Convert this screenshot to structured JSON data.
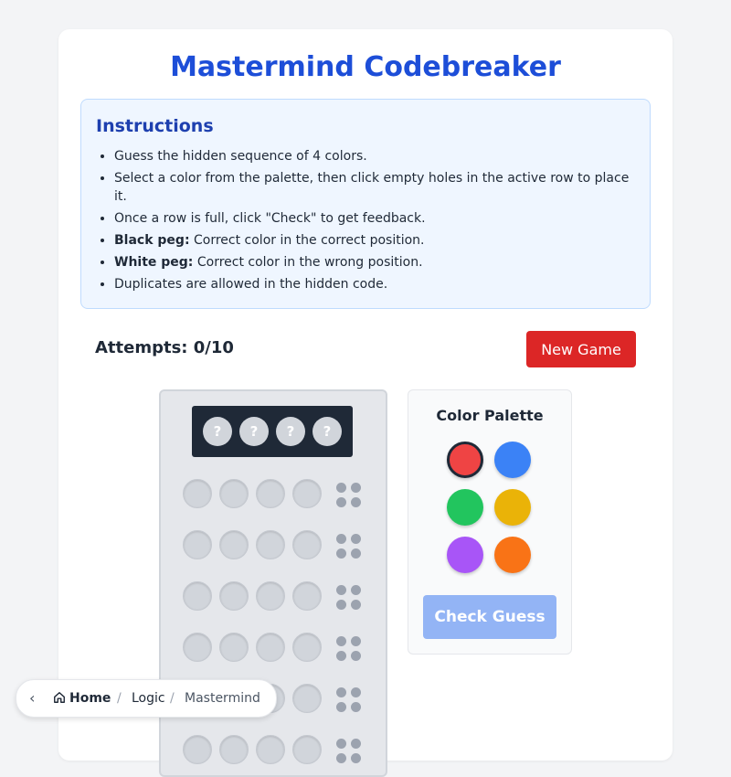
{
  "game": {
    "title": "Mastermind Codebreaker",
    "attempts_label": "Attempts: 0/10",
    "new_game_label": "New Game"
  },
  "instructions": {
    "heading": "Instructions",
    "items": [
      {
        "bold": "",
        "text": "Guess the hidden sequence of 4 colors."
      },
      {
        "bold": "",
        "text": "Select a color from the palette, then click empty holes in the active row to place it."
      },
      {
        "bold": "",
        "text": "Once a row is full, click \"Check\" to get feedback."
      },
      {
        "bold": "Black peg:",
        "text": " Correct color in the correct position."
      },
      {
        "bold": "White peg:",
        "text": " Correct color in the wrong position."
      },
      {
        "bold": "",
        "text": "Duplicates are allowed in the hidden code."
      }
    ]
  },
  "secret": {
    "pegs": [
      "?",
      "?",
      "?",
      "?"
    ]
  },
  "palette": {
    "heading": "Color Palette",
    "colors": [
      {
        "name": "red",
        "hex": "#ef4444",
        "selected": true
      },
      {
        "name": "blue",
        "hex": "#3b82f6",
        "selected": false
      },
      {
        "name": "green",
        "hex": "#22c55e",
        "selected": false
      },
      {
        "name": "yellow",
        "hex": "#eab308",
        "selected": false
      },
      {
        "name": "purple",
        "hex": "#a855f7",
        "selected": false
      },
      {
        "name": "orange",
        "hex": "#f97316",
        "selected": false
      }
    ],
    "check_label": "Check Guess"
  },
  "breadcrumb": {
    "back_icon": "chevron-left-icon",
    "home_icon": "home-icon",
    "home": "Home",
    "separator": "/",
    "section": "Logic",
    "current": "Mastermind"
  },
  "colors": {
    "title": "#1d4ed8",
    "new_game": "#dc2626",
    "check_disabled": "#93b4f5",
    "hole": "#d1d5db",
    "secret_bg": "#1f2937"
  }
}
